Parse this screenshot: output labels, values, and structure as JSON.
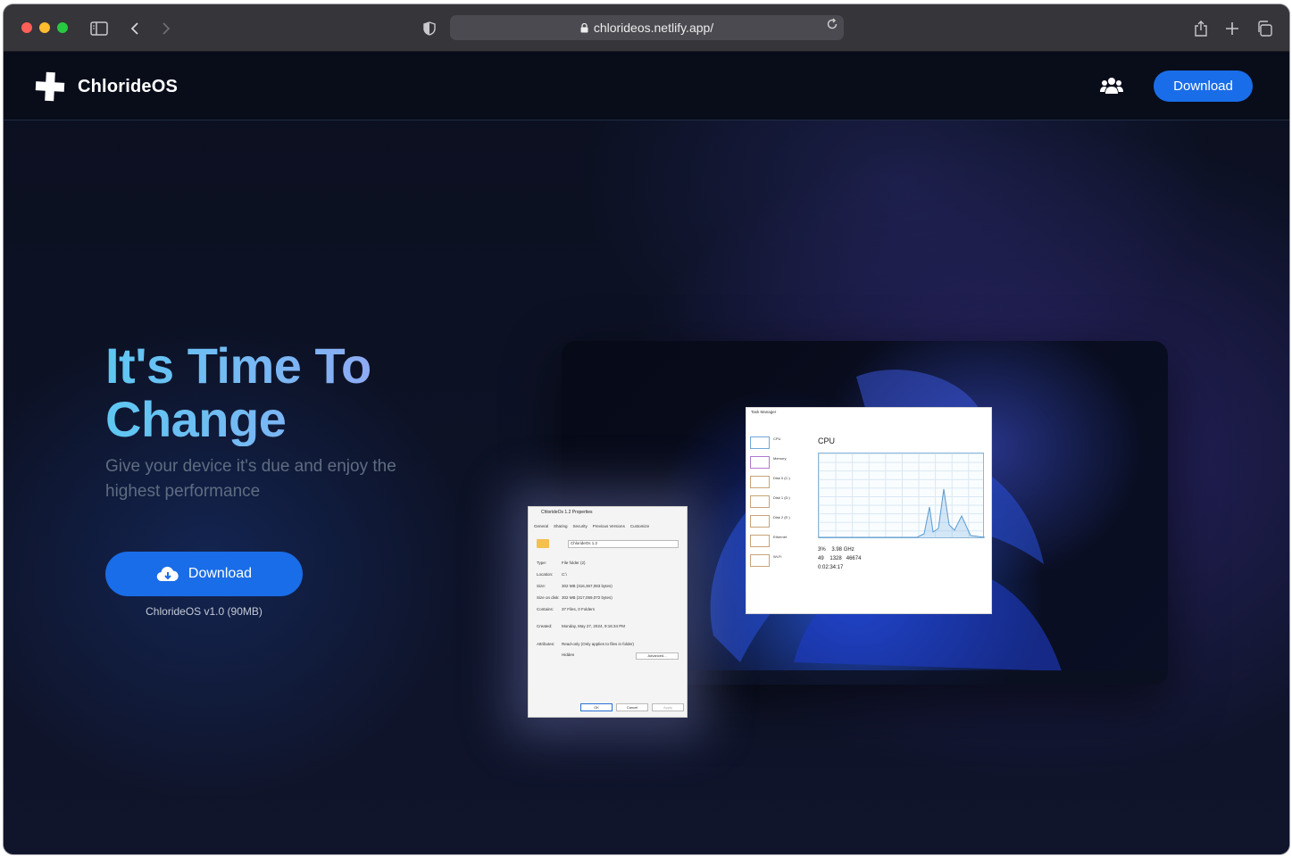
{
  "browser": {
    "url": "chlorideos.netlify.app/"
  },
  "nav": {
    "logo_text": "ChlorideOS",
    "download_label": "Download"
  },
  "hero": {
    "title": "It's Time To Change",
    "subtitle": "Give your device it's due and enjoy the highest performance",
    "download_label": "Download",
    "version_note": "ChlorideOS v1.0 (90MB)"
  },
  "preview": {
    "task_manager": {
      "title": "Task Manager",
      "heading": "CPU",
      "sidebar": [
        "CPU",
        "Memory",
        "Disk 0 (C:)",
        "Disk 1 (D:)",
        "Disk 2 (E:)",
        "Ethernet",
        "Wi-Fi"
      ],
      "utilization": "3%",
      "speed": "3.98 GHz",
      "processes": "49",
      "threads": "1328",
      "handles": "46674",
      "uptime": "0:02:34:17"
    },
    "properties": {
      "title": "ChlorideOs 1.2 Properties",
      "tabs": [
        "General",
        "Sharing",
        "Security",
        "Previous Versions",
        "Customize"
      ],
      "name": "ChlorideOs 1.2",
      "rows": [
        {
          "k": "Type:",
          "v": "File folder (2)"
        },
        {
          "k": "Location:",
          "v": "C:\\"
        },
        {
          "k": "Size:",
          "v": "302 MB (316,367,083 bytes)"
        },
        {
          "k": "Size on disk:",
          "v": "302 MB (317,059,072 bytes)"
        },
        {
          "k": "Contains:",
          "v": "37 Files, 0 Folders"
        },
        {
          "k": "Created:",
          "v": "Monday, May 27, 2024, 9:16:34 PM"
        },
        {
          "k": "Attributes:",
          "v": "Read-only (Only applies to files in folder)"
        }
      ],
      "hidden_label": "Hidden",
      "advanced_label": "Advanced...",
      "ok_label": "OK",
      "cancel_label": "Cancel",
      "apply_label": "Apply"
    }
  },
  "colors": {
    "accent": "#1a6de8",
    "background": "#0c1020"
  },
  "icons": [
    "sidebar-icon",
    "back-icon",
    "forward-icon",
    "shield-icon",
    "lock-icon",
    "reload-icon",
    "share-icon",
    "plus-icon",
    "tabs-icon",
    "chloride-logo-icon",
    "users-icon",
    "cloud-download-icon"
  ]
}
